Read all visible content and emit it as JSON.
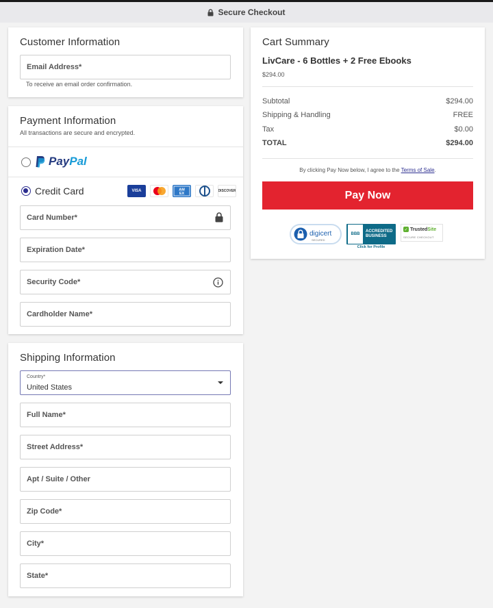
{
  "header": {
    "title": "Secure Checkout"
  },
  "customer": {
    "title": "Customer Information",
    "email_placeholder": "Email Address*",
    "email_hint": "To receive an email order confirmation."
  },
  "payment": {
    "title": "Payment Information",
    "subtitle": "All transactions are secure and encrypted.",
    "paypal": {
      "pay": "Pay",
      "pal": "Pal"
    },
    "credit_card_label": "Credit Card",
    "card_logos": [
      {
        "name": "VISA",
        "color": "#1a3e9a"
      },
      {
        "name": "Mastercard",
        "color": "#ffffff"
      },
      {
        "name": "AMEX",
        "color": "#2e78c7"
      },
      {
        "name": "Diners Club",
        "color": "#ffffff"
      },
      {
        "name": "DISCOVER",
        "color": "#ffffff"
      }
    ],
    "card_number": "Card Number*",
    "expiration": "Expiration Date*",
    "security_code": "Security Code*",
    "cardholder": "Cardholder Name*"
  },
  "shipping": {
    "title": "Shipping Information",
    "country_label": "Country*",
    "country_value": "United States",
    "full_name": "Full Name*",
    "street": "Street Address*",
    "apt": "Apt / Suite / Other",
    "zip": "Zip Code*",
    "city": "City*",
    "state": "State*"
  },
  "cart": {
    "title": "Cart Summary",
    "product_name": "LivCare - 6 Bottles + 2 Free Ebooks",
    "product_price": "$294.00",
    "rows": [
      {
        "label": "Subtotal",
        "value": "$294.00"
      },
      {
        "label": "Shipping & Handling",
        "value": "FREE"
      },
      {
        "label": "Tax",
        "value": "$0.00"
      },
      {
        "label": "TOTAL",
        "value": "$294.00"
      }
    ],
    "terms_prefix": "By clicking Pay Now below, I agree to the",
    "terms_link": "Terms of Sale",
    "terms_suffix": ".",
    "pay_button": "Pay Now",
    "badges": {
      "digicert": "digicert",
      "digicert_sub": "SECURED",
      "bbb_logo": "BBB",
      "bbb_line1": "ACCREDITED",
      "bbb_line2": "BUSINESS",
      "bbb_foot": "Click for Profile",
      "trusted_a": "Trusted",
      "trusted_b": "Site",
      "trusted_sub": "SECURE CHECKOUT"
    }
  },
  "colors": {
    "accent": "#e3232f",
    "brand_blue": "#2b2d8f"
  }
}
